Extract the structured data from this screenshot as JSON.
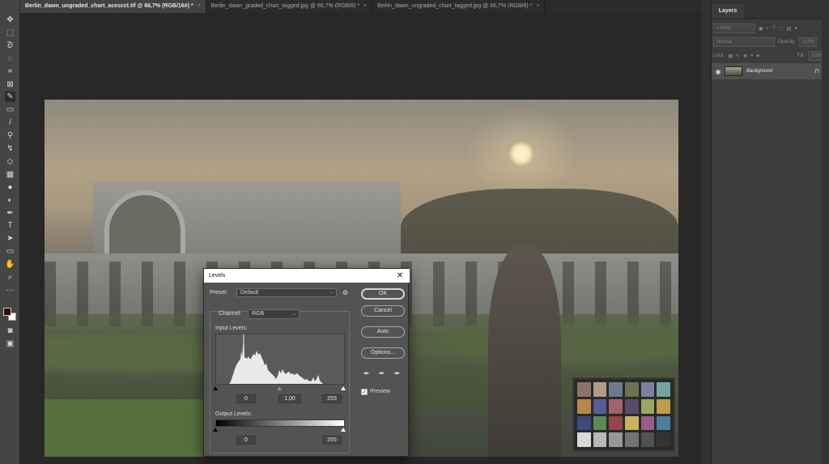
{
  "tabs": [
    {
      "label": "Berlin_dawn_ungraded_chart_acesсct.tif @ 66,7% (RGB/16#) *",
      "close": "×"
    },
    {
      "label": "Berlin_dawn_graded_chart_tagged.jpg @ 66,7% (RGB/8) *",
      "close": "×"
    },
    {
      "label": "Berlin_dawn_ungraded_chart_tagged.jpg @ 66,7% (RGB/8) *",
      "close": "×"
    }
  ],
  "tools": [
    {
      "name": "move-tool",
      "glyph": "✥"
    },
    {
      "name": "marquee-tool",
      "glyph": "⬚"
    },
    {
      "name": "lasso-tool",
      "glyph": "ᘐ"
    },
    {
      "name": "quick-select-tool",
      "glyph": "◌"
    },
    {
      "name": "crop-tool",
      "glyph": "⌗"
    },
    {
      "name": "frame-tool",
      "glyph": "⊠"
    },
    {
      "name": "eyedropper-tool",
      "glyph": "✎"
    },
    {
      "name": "healing-tool",
      "glyph": "▭"
    },
    {
      "name": "brush-tool",
      "glyph": "/"
    },
    {
      "name": "stamp-tool",
      "glyph": "⚲"
    },
    {
      "name": "history-brush-tool",
      "glyph": "↯"
    },
    {
      "name": "eraser-tool",
      "glyph": "◇"
    },
    {
      "name": "gradient-tool",
      "glyph": "▦"
    },
    {
      "name": "blur-tool",
      "glyph": "●"
    },
    {
      "name": "dodge-tool",
      "glyph": "◐"
    },
    {
      "name": "pen-tool",
      "glyph": "✒"
    },
    {
      "name": "type-tool",
      "glyph": "T"
    },
    {
      "name": "path-select-tool",
      "glyph": "➤"
    },
    {
      "name": "shape-tool",
      "glyph": "▭"
    },
    {
      "name": "hand-tool",
      "glyph": "✋"
    },
    {
      "name": "zoom-tool",
      "glyph": "⌕"
    },
    {
      "name": "more-tools",
      "glyph": "···"
    }
  ],
  "layers_panel": {
    "tab_label": "Layers",
    "kind_placeholder": "Kind",
    "blend_mode": "Normal",
    "opacity_label": "Opacity:",
    "opacity_value": "100%",
    "lock_label": "Lock:",
    "fill_label": "Fill:",
    "fill_value": "100%",
    "layers": [
      {
        "name": "Background",
        "visible": true,
        "locked": true
      }
    ]
  },
  "levels_dialog": {
    "title": "Levels",
    "close": "✕",
    "preset_label": "Preset:",
    "preset_value": "Default",
    "channel_label": "Channel:",
    "channel_value": "RGB",
    "input_levels_label": "Input Levels:",
    "input_black": "0",
    "input_gamma": "1,00",
    "input_white": "255",
    "output_levels_label": "Output Levels:",
    "output_black": "0",
    "output_white": "255",
    "buttons": {
      "ok": "OK",
      "cancel": "Cancel",
      "auto": "Auto",
      "options": "Options..."
    },
    "preview_label": "Preview",
    "preview_checked": true
  },
  "colors": {
    "foreground": "#2a1208",
    "background": "#ffffff"
  },
  "color_chart_patches": [
    "#8a7468",
    "#b39b86",
    "#6c7a90",
    "#6a7352",
    "#7f7ea0",
    "#75a39e",
    "#b8874a",
    "#545e95",
    "#a5606a",
    "#5a4a6a",
    "#98a85c",
    "#c19a4e",
    "#3f4880",
    "#5e8a58",
    "#94454a",
    "#c8b45a",
    "#9a5c8a",
    "#4b7ea0",
    "#d8d8d8",
    "#b8b8b8",
    "#979797",
    "#737373",
    "#525252",
    "#333333"
  ]
}
